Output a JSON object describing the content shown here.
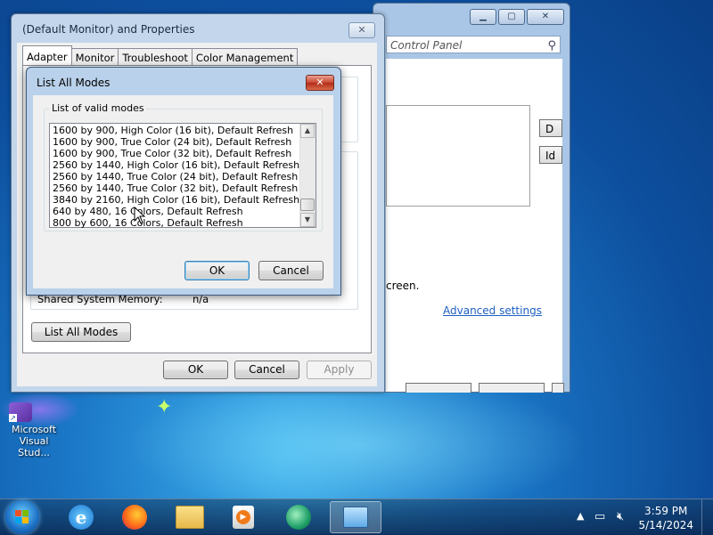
{
  "control_panel": {
    "search_placeholder": "Control Panel",
    "btn_1": "D",
    "btn_2": "Id",
    "text_fragment": "creen.",
    "advanced_link": "Advanced settings"
  },
  "properties_window": {
    "title": "(Default Monitor) and  Properties",
    "tabs": [
      "Adapter",
      "Monitor",
      "Troubleshoot",
      "Color Management"
    ],
    "shared_memory_label": "Shared System Memory:",
    "shared_memory_value": "n/a",
    "list_all_modes_button": "List All Modes",
    "ok_button": "OK",
    "cancel_button": "Cancel",
    "apply_button": "Apply"
  },
  "modes_dialog": {
    "title": "List All Modes",
    "group_label": "List of valid modes",
    "modes": [
      "1600 by 900, High Color (16 bit), Default Refresh",
      "1600 by 900, True Color (24 bit), Default Refresh",
      "1600 by 900, True Color (32 bit), Default Refresh",
      "2560 by 1440, High Color (16 bit), Default Refresh",
      "2560 by 1440, True Color (24 bit), Default Refresh",
      "2560 by 1440, True Color (32 bit), Default Refresh",
      "3840 by 2160, High Color (16 bit), Default Refresh",
      "640 by 480, 16 Colors, Default Refresh",
      "800 by 600, 16 Colors, Default Refresh"
    ],
    "ok_button": "OK",
    "cancel_button": "Cancel"
  },
  "desktop": {
    "icon_label": "Microsoft Visual Stud..."
  },
  "taskbar": {
    "items": [
      "internet-explorer",
      "firefox",
      "file-explorer",
      "media-player",
      "app-green",
      "display-settings"
    ],
    "time": "3:59 PM",
    "date": "5/14/2024",
    "tray_arrow": "▲"
  }
}
